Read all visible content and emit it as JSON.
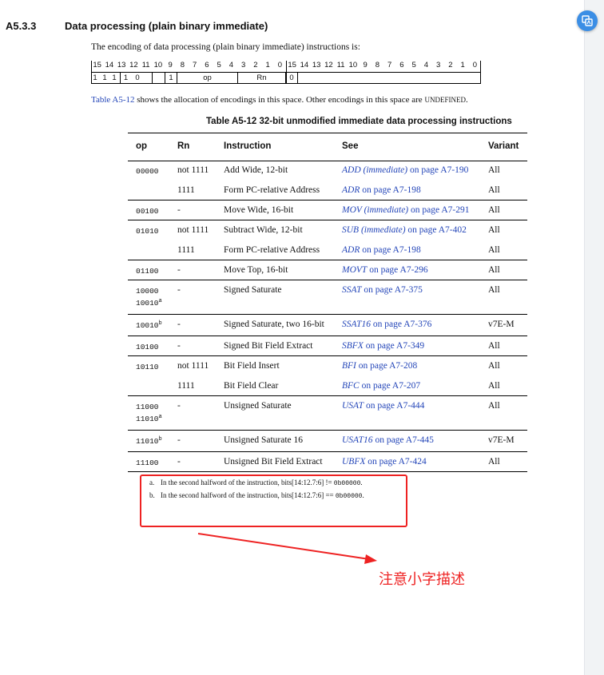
{
  "section": {
    "number": "A5.3.3",
    "title": "Data processing (plain binary immediate)"
  },
  "intro": "The encoding of data processing (plain binary immediate) instructions is:",
  "encoding": {
    "bit_numbers": [
      "15",
      "14",
      "13",
      "12",
      "11",
      "10",
      "9",
      "8",
      "7",
      "6",
      "5",
      "4",
      "3",
      "2",
      "1",
      "0",
      "15",
      "14",
      "13",
      "12",
      "11",
      "10",
      "9",
      "8",
      "7",
      "6",
      "5",
      "4",
      "3",
      "2",
      "1",
      "0"
    ],
    "fields": [
      "1",
      "1",
      "1",
      "1",
      "0",
      "",
      "1",
      "op",
      "Rn",
      "0",
      ""
    ]
  },
  "allocation": {
    "link": "Table A5-12",
    "text": " shows the allocation of encodings in this space. Other encodings in this space are ",
    "undefined": "UNDEFINED",
    "end": "."
  },
  "table": {
    "caption": "Table A5-12 32-bit unmodified immediate data processing instructions",
    "headers": [
      "op",
      "Rn",
      "Instruction",
      "See",
      "Variant"
    ],
    "rows": [
      {
        "op": "00000",
        "op2": "",
        "op2_sup": "",
        "op_sup": "",
        "rn": "not 1111",
        "instruction": "Add Wide, 12-bit",
        "see": "ADD (immediate)",
        "page": " on page A7-190",
        "variant": "All"
      },
      {
        "op": "",
        "op2": "",
        "op2_sup": "",
        "op_sup": "",
        "rn": "1111",
        "instruction": "Form PC-relative Address",
        "see": "ADR",
        "page": " on page A7-198",
        "variant": "All"
      },
      {
        "op": "00100",
        "op2": "",
        "op2_sup": "",
        "op_sup": "",
        "rn": "-",
        "instruction": "Move Wide, 16-bit",
        "see": "MOV (immediate)",
        "page": " on page A7-291",
        "variant": "All"
      },
      {
        "op": "01010",
        "op2": "",
        "op2_sup": "",
        "op_sup": "",
        "rn": "not 1111",
        "instruction": "Subtract Wide, 12-bit",
        "see": "SUB (immediate)",
        "page": " on page A7-402",
        "variant": "All"
      },
      {
        "op": "",
        "op2": "",
        "op2_sup": "",
        "op_sup": "",
        "rn": "1111",
        "instruction": "Form PC-relative Address",
        "see": "ADR",
        "page": " on page A7-198",
        "variant": "All"
      },
      {
        "op": "01100",
        "op2": "",
        "op2_sup": "",
        "op_sup": "",
        "rn": "-",
        "instruction": "Move Top, 16-bit",
        "see": "MOVT",
        "page": " on page A7-296",
        "variant": "All"
      },
      {
        "op": "10000",
        "op2": "10010",
        "op2_sup": "a",
        "op_sup": "",
        "rn": "-",
        "instruction": "Signed Saturate",
        "see": "SSAT",
        "page": " on page A7-375",
        "variant": "All"
      },
      {
        "op": "10010",
        "op2": "",
        "op2_sup": "",
        "op_sup": "b",
        "rn": "-",
        "instruction": "Signed Saturate, two 16-bit",
        "see": "SSAT16",
        "page": " on page A7-376",
        "variant": "v7E-M"
      },
      {
        "op": "10100",
        "op2": "",
        "op2_sup": "",
        "op_sup": "",
        "rn": "-",
        "instruction": "Signed Bit Field Extract",
        "see": "SBFX",
        "page": " on page A7-349",
        "variant": "All"
      },
      {
        "op": "10110",
        "op2": "",
        "op2_sup": "",
        "op_sup": "",
        "rn": "not 1111",
        "instruction": "Bit Field Insert",
        "see": "BFI",
        "page": " on page A7-208",
        "variant": "All"
      },
      {
        "op": "",
        "op2": "",
        "op2_sup": "",
        "op_sup": "",
        "rn": "1111",
        "instruction": "Bit Field Clear",
        "see": "BFC",
        "page": " on page A7-207",
        "variant": "All"
      },
      {
        "op": "11000",
        "op2": "11010",
        "op2_sup": "a",
        "op_sup": "",
        "rn": "-",
        "instruction": "Unsigned Saturate",
        "see": "USAT",
        "page": " on page A7-444",
        "variant": "All"
      },
      {
        "op": "11010",
        "op2": "",
        "op2_sup": "",
        "op_sup": "b",
        "rn": "-",
        "instruction": "Unsigned Saturate 16",
        "see": "USAT16",
        "page": " on page A7-445",
        "variant": "v7E-M"
      },
      {
        "op": "11100",
        "op2": "",
        "op2_sup": "",
        "op_sup": "",
        "rn": "-",
        "instruction": "Unsigned Bit Field Extract",
        "see": "UBFX",
        "page": " on page A7-424",
        "variant": "All"
      }
    ],
    "footnotes": [
      {
        "label": "a.",
        "text": "In the second halfword of the instruction, bits[14:12.7:6] != ",
        "code": "0b00000",
        "end": "."
      },
      {
        "label": "b.",
        "text": "In the second halfword of the instruction, bits[14:12.7:6] == ",
        "code": "0b00000",
        "end": "."
      }
    ]
  },
  "annotation": {
    "note": "注意小字描述",
    "color": "#ee2222"
  },
  "icons": {
    "fab": "translate-icon"
  }
}
